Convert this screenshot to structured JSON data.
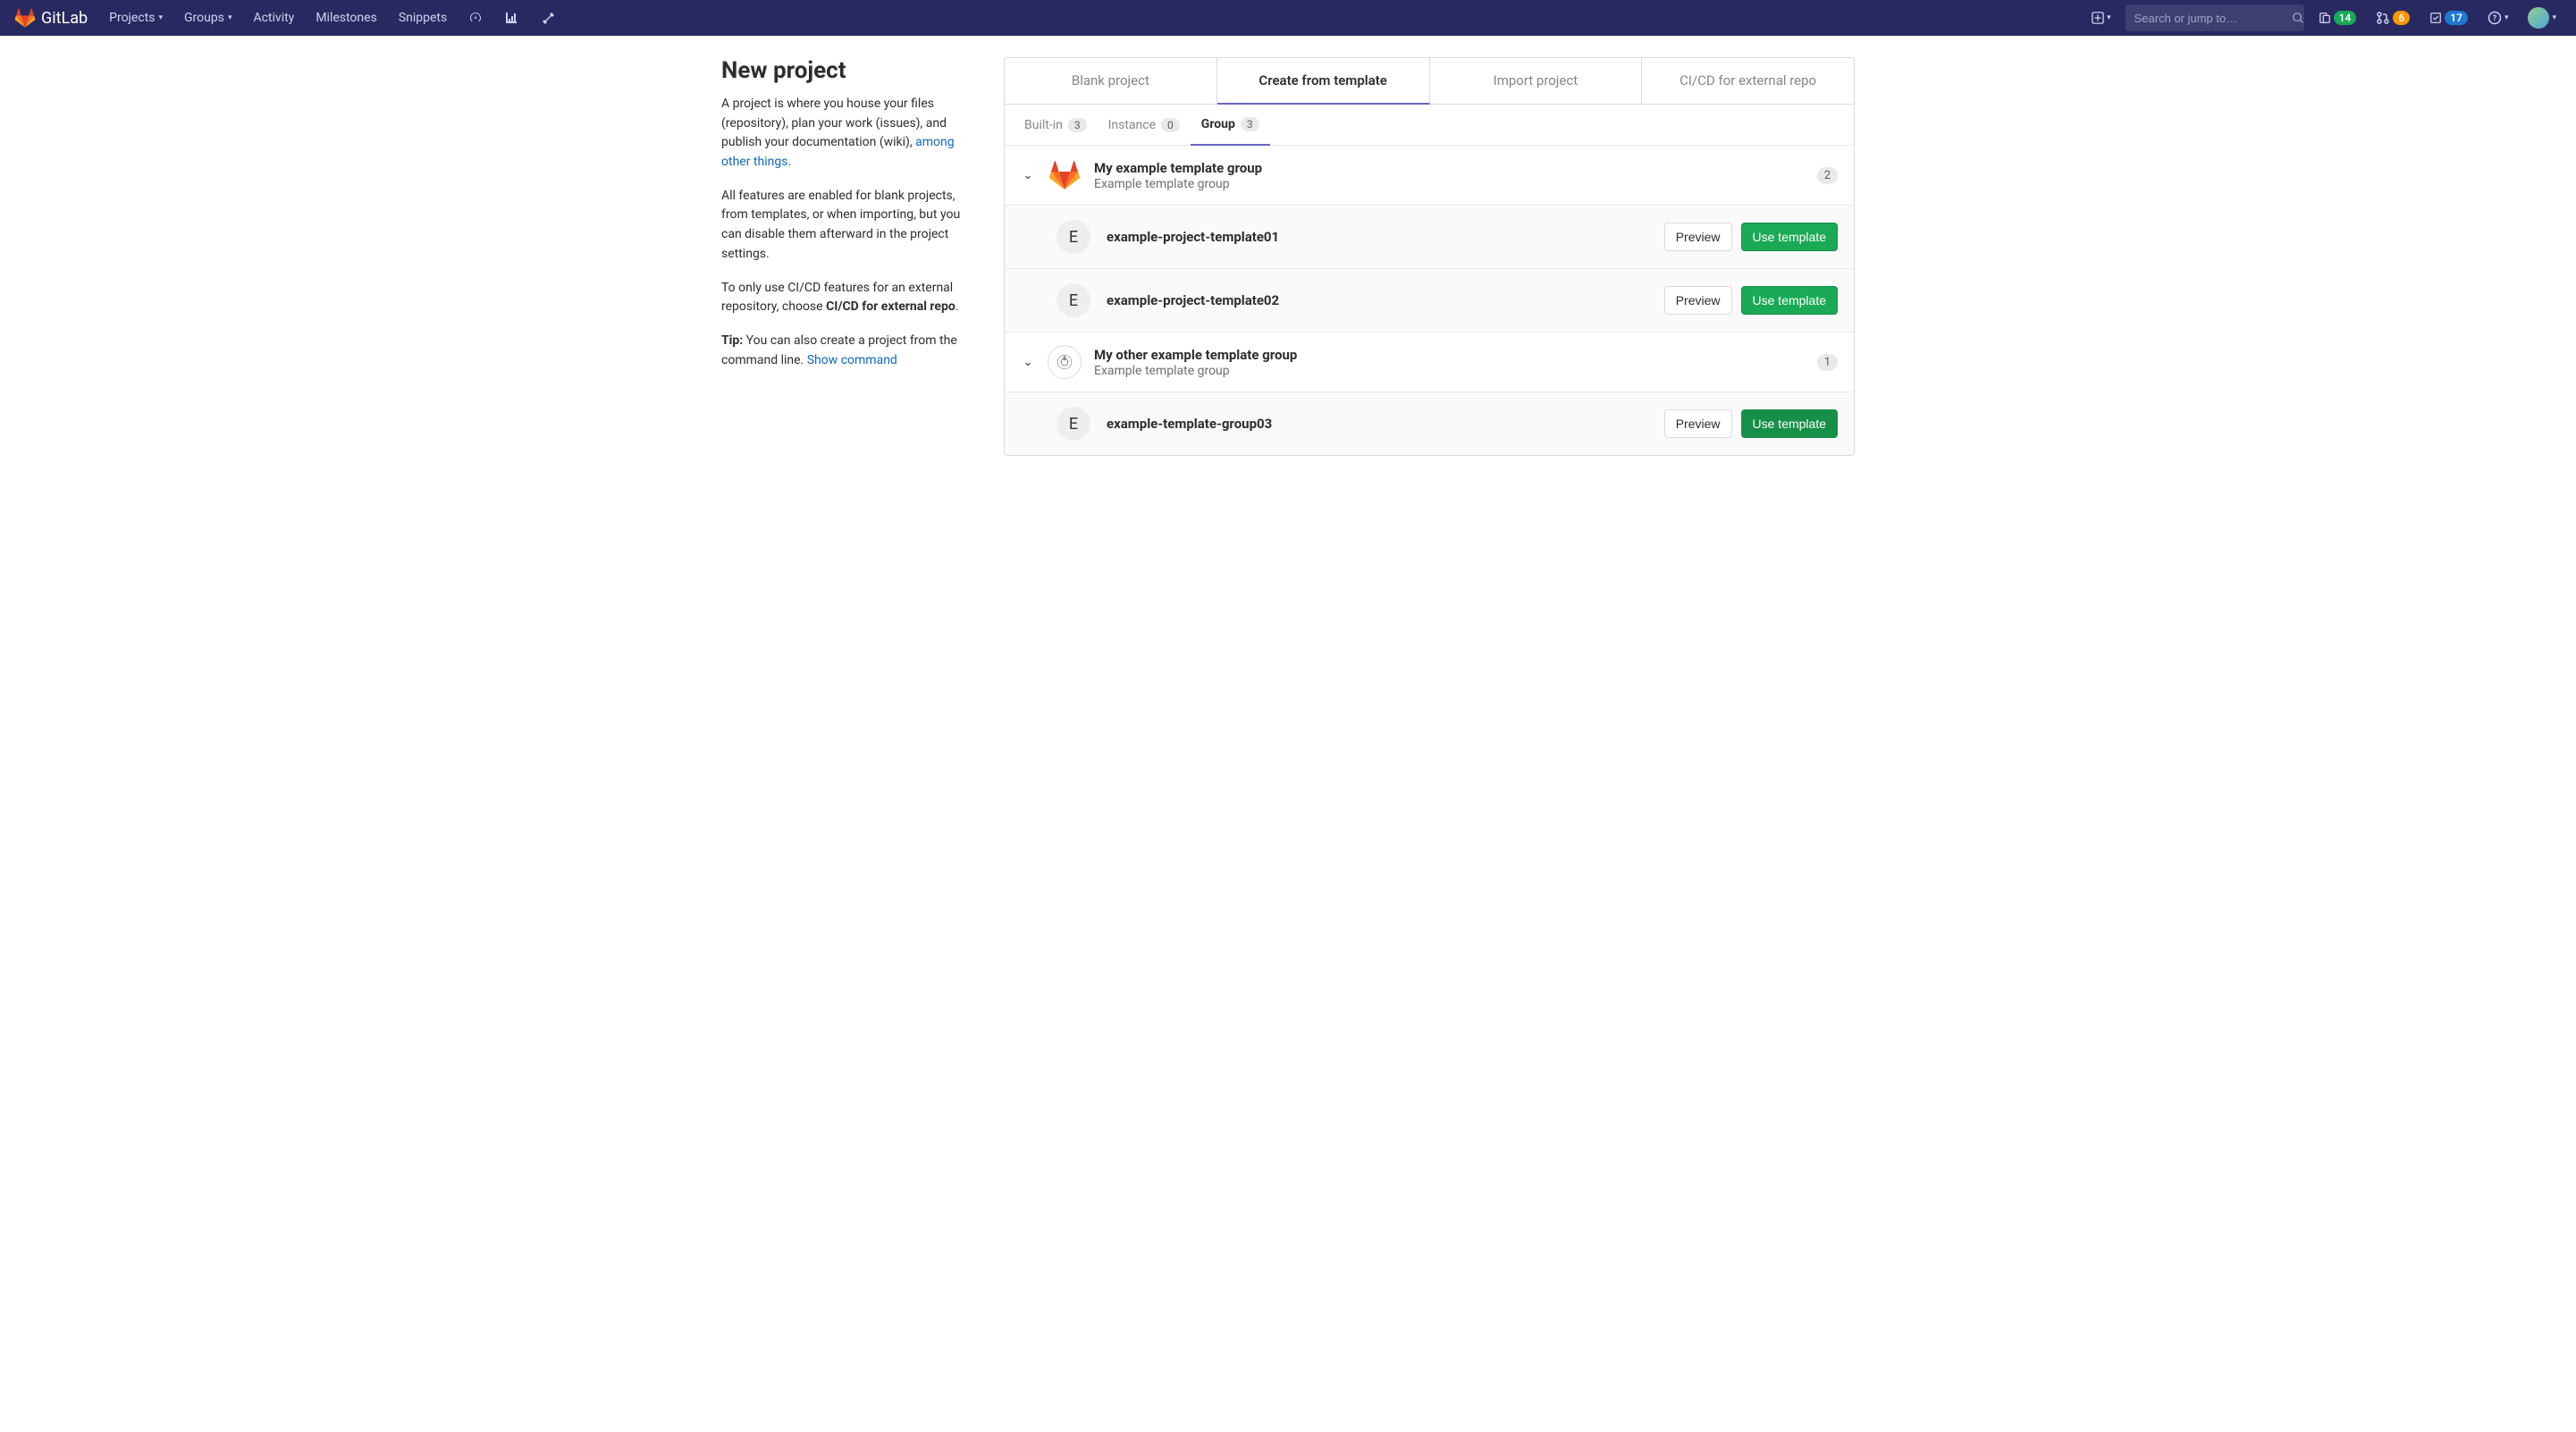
{
  "navbar": {
    "brand": "GitLab",
    "links": {
      "projects": "Projects",
      "groups": "Groups",
      "activity": "Activity",
      "milestones": "Milestones",
      "snippets": "Snippets"
    },
    "search_placeholder": "Search or jump to…",
    "badges": {
      "issues": "14",
      "merge_requests": "6",
      "todos": "17"
    }
  },
  "sidebar": {
    "heading": "New project",
    "p1_prefix": "A project is where you house your files (repository), plan your work (issues), and publish your documentation (wiki), ",
    "p1_link": "among other things",
    "p1_suffix": ".",
    "p2": "All features are enabled for blank projects, from templates, or when importing, but you can disable them afterward in the project settings.",
    "p3_prefix": "To only use CI/CD features for an external repository, choose ",
    "p3_strong": "CI/CD for external repo",
    "p3_suffix": ".",
    "p4_strong": "Tip:",
    "p4_mid": " You can also create a project from the command line. ",
    "p4_link": "Show command"
  },
  "tabs": {
    "blank": "Blank project",
    "create": "Create from template",
    "import": "Import project",
    "cicd": "CI/CD for external repo"
  },
  "subtabs": {
    "builtin_label": "Built-in",
    "builtin_count": "3",
    "instance_label": "Instance",
    "instance_count": "0",
    "group_label": "Group",
    "group_count": "3"
  },
  "groups": [
    {
      "title": "My example template group",
      "subtitle": "Example template group",
      "count": "2",
      "avatar_type": "gitlab",
      "templates": [
        {
          "avatar_letter": "E",
          "name": "example-project-template01",
          "preview": "Preview",
          "use": "Use template"
        },
        {
          "avatar_letter": "E",
          "name": "example-project-template02",
          "preview": "Preview",
          "use": "Use template"
        }
      ]
    },
    {
      "title": "My other example template group",
      "subtitle": "Example template group",
      "count": "1",
      "avatar_type": "ring",
      "templates": [
        {
          "avatar_letter": "E",
          "name": "example-template-group03",
          "preview": "Preview",
          "use": "Use template",
          "hover": true
        }
      ]
    }
  ]
}
